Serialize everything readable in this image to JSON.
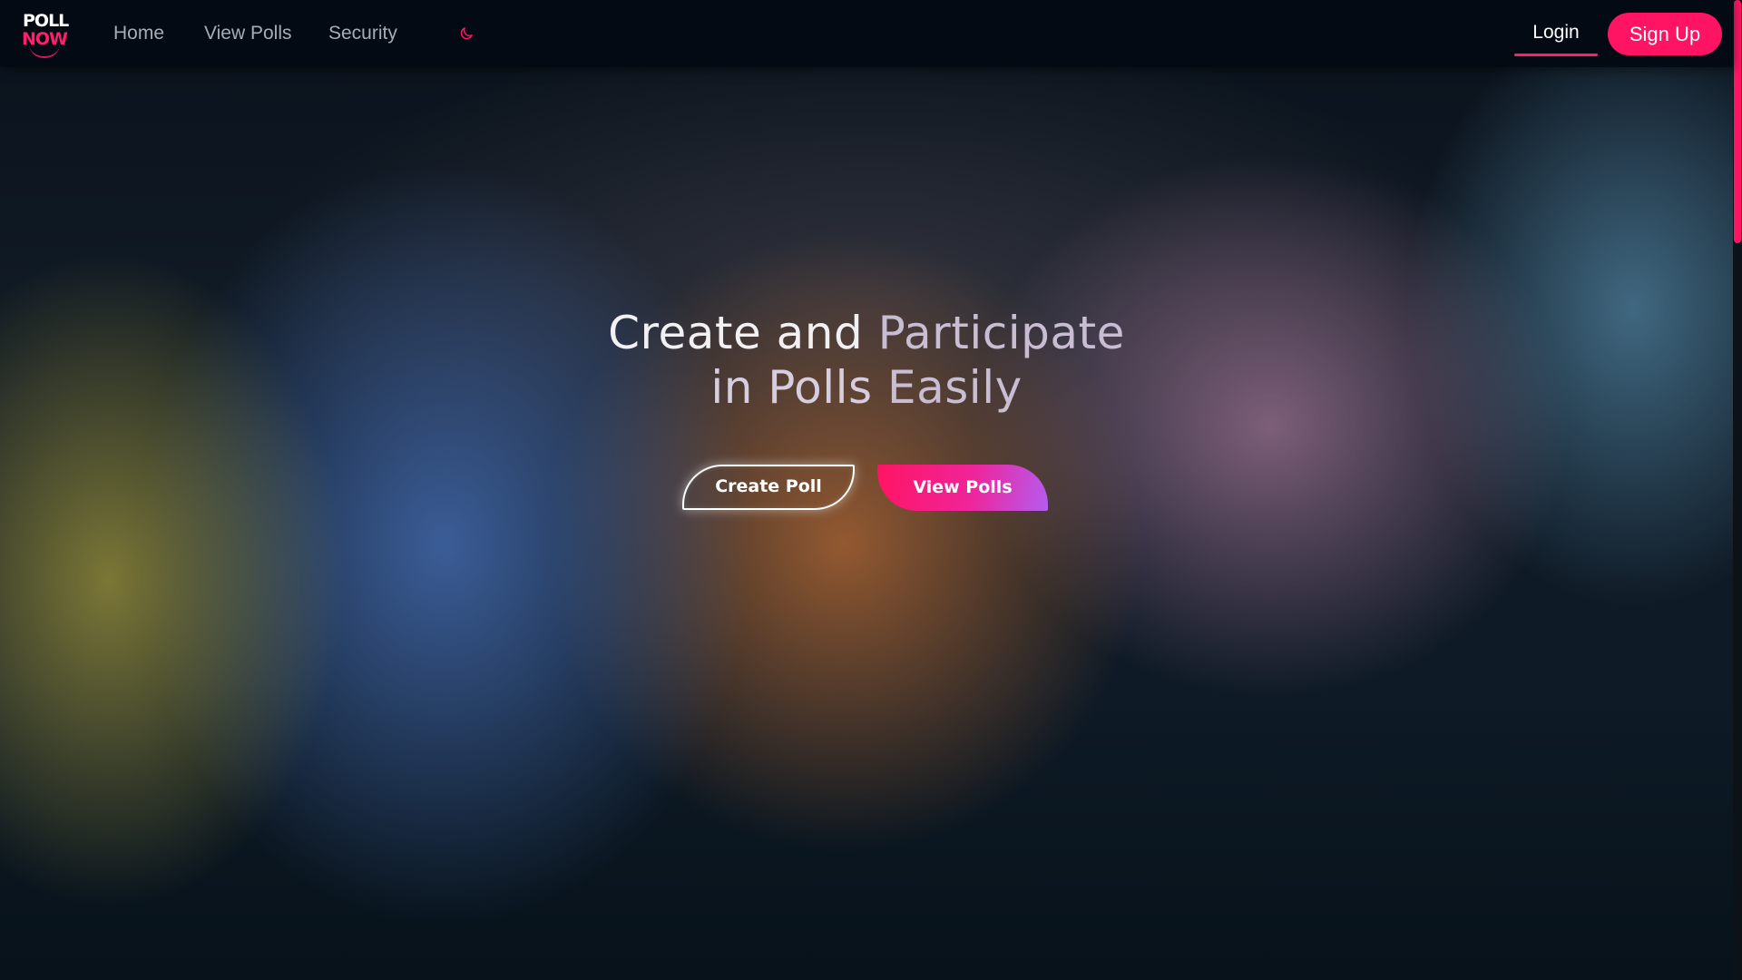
{
  "brand": {
    "logo_line1": "POLL",
    "logo_line2": "NOW",
    "accent_color": "#ff1463"
  },
  "nav": {
    "links": [
      {
        "label": "Home"
      },
      {
        "label": "View Polls"
      },
      {
        "label": "Security"
      }
    ],
    "theme_toggle_icon": "moon-icon",
    "login_label": "Login",
    "signup_label": "Sign Up"
  },
  "hero": {
    "title_part1": "Create and",
    "title_part2": "Participate",
    "title_part3": "in Polls",
    "title_part4": "Easily",
    "create_poll_label": "Create Poll",
    "view_polls_label": "View Polls"
  }
}
